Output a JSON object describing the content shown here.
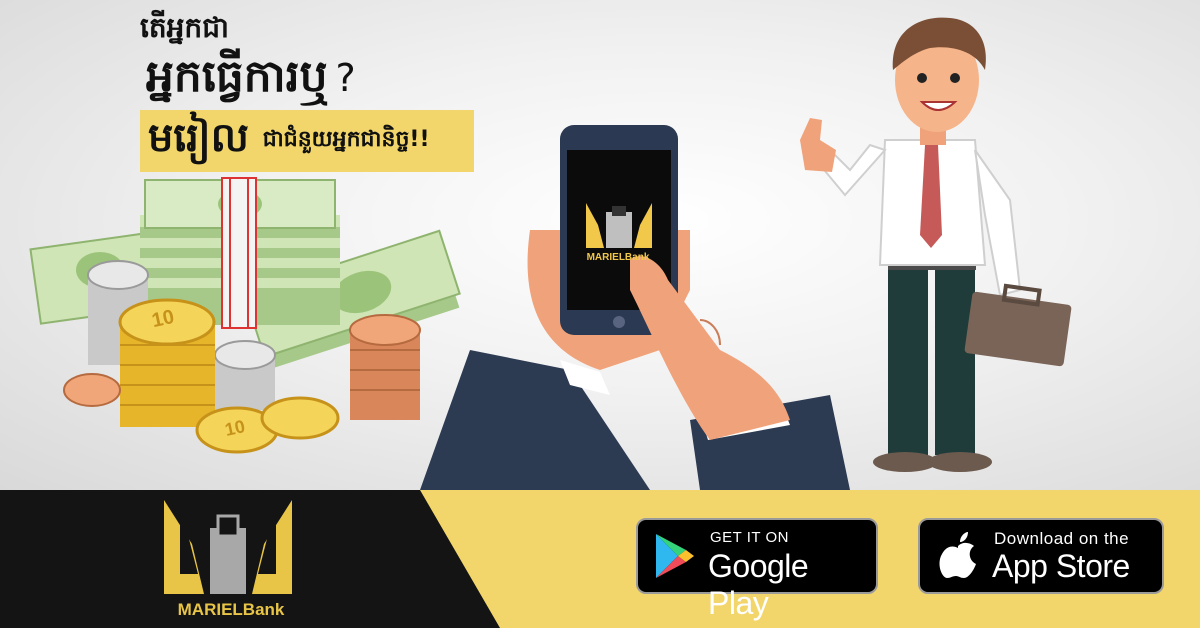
{
  "headline": {
    "line1": "តើអ្នកជា",
    "line2": "អ្នកធ្វើការឬ",
    "question_mark": "?",
    "line3_big": "មរៀល",
    "line3_small": "ជាជំនួយអ្នកជានិច្ច!!"
  },
  "brand": {
    "name": "MARIELBank"
  },
  "phone": {
    "brand": "MARIELBank"
  },
  "coins": {
    "denomination": "10"
  },
  "stores": {
    "google_top": "GET IT ON",
    "google_bottom": "Google Play",
    "apple_top": "Download on the",
    "apple_bottom": "App Store"
  },
  "colors": {
    "yellow": "#f2d66b",
    "dark": "#111111",
    "gold": "#e8c547",
    "cash_green": "#b9d79a"
  }
}
